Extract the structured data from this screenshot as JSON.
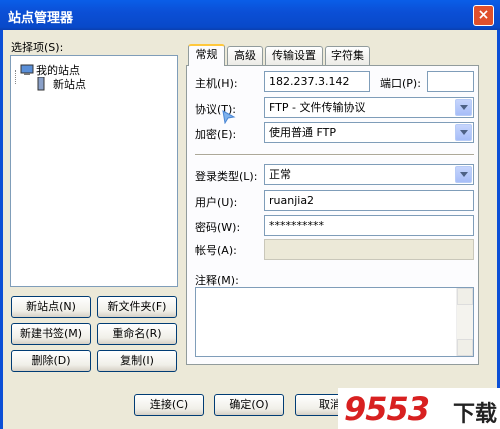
{
  "window": {
    "title": "站点管理器",
    "close_glyph": "×"
  },
  "left": {
    "select_label": "选择项(S):",
    "tree": [
      {
        "label": "我的站点",
        "icon": "computer-icon"
      },
      {
        "label": "新站点",
        "icon": "server-icon",
        "selected": true
      }
    ],
    "buttons": {
      "new_site": "新站点(N)",
      "new_folder": "新文件夹(F)",
      "new_bookmark": "新建书签(M)",
      "rename": "重命名(R)",
      "delete": "删除(D)",
      "copy": "复制(I)"
    }
  },
  "tabs": [
    {
      "label": "常规",
      "active": true
    },
    {
      "label": "高级"
    },
    {
      "label": "传输设置"
    },
    {
      "label": "字符集"
    }
  ],
  "form": {
    "host_label": "主机(H):",
    "host_value": "182.237.3.142",
    "port_label": "端口(P):",
    "port_value": "",
    "protocol_label": "协议(T):",
    "protocol_value": "FTP - 文件传输协议",
    "encryption_label": "加密(E):",
    "encryption_value": "使用普通 FTP",
    "logon_type_label": "登录类型(L):",
    "logon_type_value": "正常",
    "user_label": "用户(U):",
    "user_value": "ruanjia2",
    "password_label": "密码(W):",
    "password_value": "**********",
    "account_label": "帐号(A):",
    "account_value": "",
    "comments_label": "注释(M):"
  },
  "footer": {
    "connect": "连接(C)",
    "ok": "确定(O)",
    "cancel": "取消"
  },
  "watermark": {
    "text": "9553",
    "cn": "下载"
  }
}
